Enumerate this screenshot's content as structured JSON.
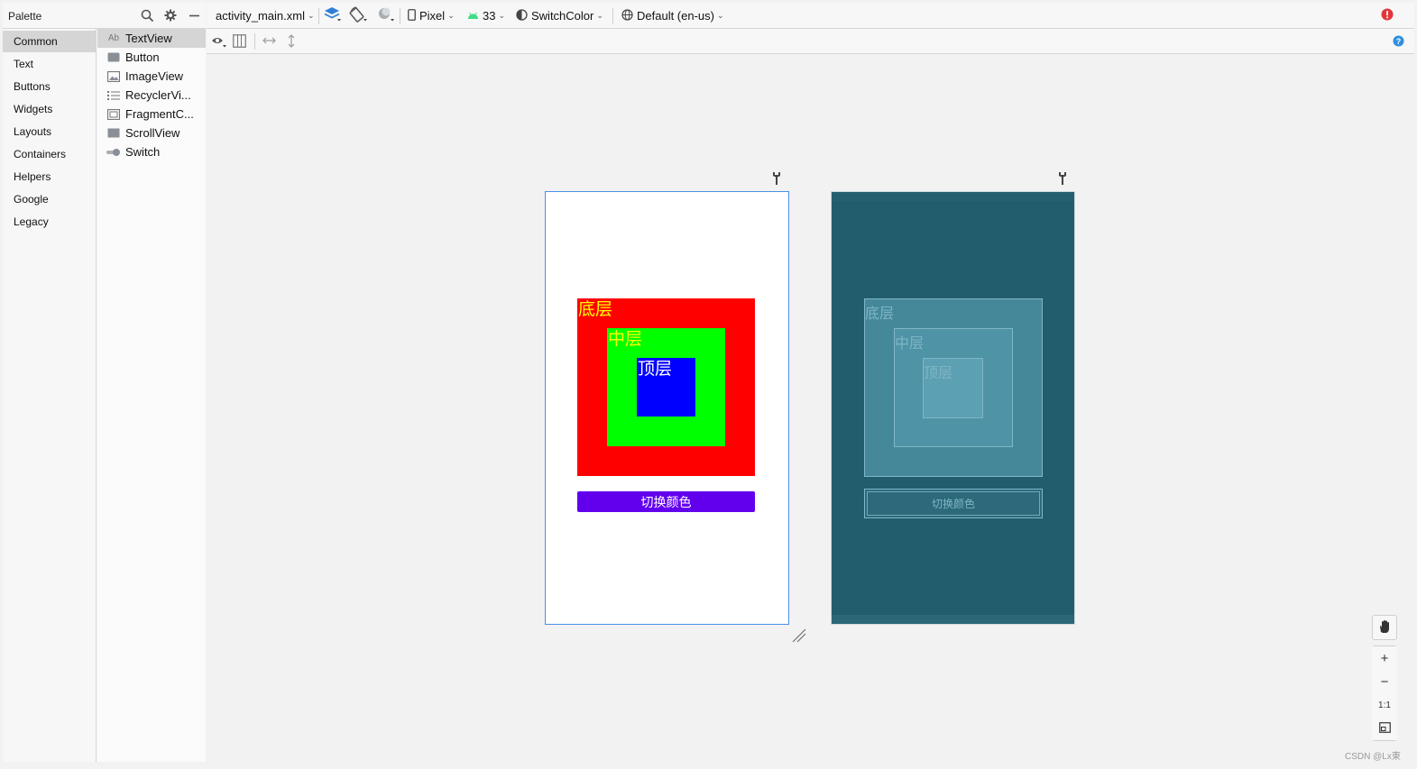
{
  "palette": {
    "title": "Palette",
    "categories": [
      "Common",
      "Text",
      "Buttons",
      "Widgets",
      "Layouts",
      "Containers",
      "Helpers",
      "Google",
      "Legacy"
    ],
    "selected_category": "Common",
    "components": [
      {
        "label": "TextView",
        "icon": "textview-icon",
        "icon_text": "Ab"
      },
      {
        "label": "Button",
        "icon": "button-icon"
      },
      {
        "label": "ImageView",
        "icon": "image-icon"
      },
      {
        "label": "RecyclerVi...",
        "icon": "list-icon"
      },
      {
        "label": "FragmentC...",
        "icon": "fragment-icon"
      },
      {
        "label": "ScrollView",
        "icon": "scrollview-icon"
      },
      {
        "label": "Switch",
        "icon": "switch-icon"
      }
    ]
  },
  "toolbar": {
    "file": "activity_main.xml",
    "device": "Pixel",
    "api_level": "33",
    "theme": "SwitchColor",
    "locale": "Default (en-us)"
  },
  "design": {
    "bottom_layer_label": "底层",
    "middle_layer_label": "中层",
    "top_layer_label": "顶层",
    "button_label": "切换颜色",
    "colors": {
      "bottom": "#ff0000",
      "middle": "#00ff00",
      "top": "#0000ff",
      "bottom_text": "#ffff00",
      "middle_text": "#ffff00",
      "top_text": "#ffffff",
      "button": "#6200ee"
    }
  },
  "blueprint": {
    "bottom_layer_label": "底层",
    "middle_layer_label": "中层",
    "top_layer_label": "顶层",
    "button_label": "切换颜色"
  },
  "zoom": {
    "zoom_in": "+",
    "zoom_out": "−",
    "actual_size": "1:1"
  },
  "watermark": "CSDN @Lx東"
}
